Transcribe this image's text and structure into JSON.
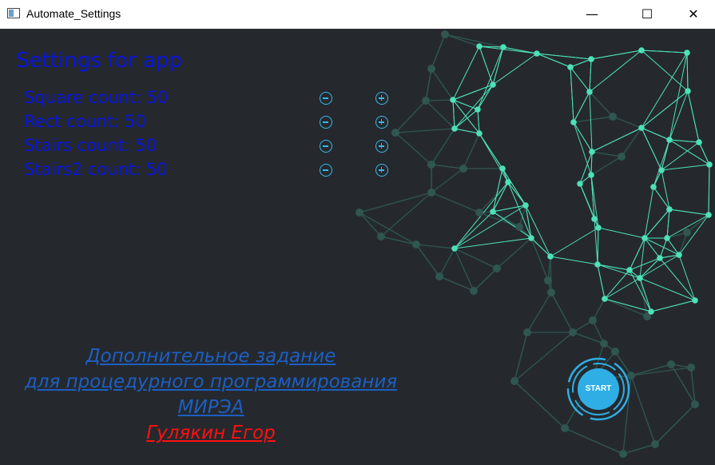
{
  "window": {
    "title": "Automate_Settings",
    "minimize_glyph": "—",
    "maximize_glyph": "☐",
    "close_glyph": "✕"
  },
  "settings": {
    "heading": "Settings for app",
    "counters": [
      {
        "label": "Square count: 50"
      },
      {
        "label": "Rect count: 50"
      },
      {
        "label": "Stairs count: 50"
      },
      {
        "label": "Stairs2 count: 50"
      }
    ]
  },
  "info": {
    "line1": "Дополнительное задание ",
    "line2": "для процедурного программирования ",
    "line3": "МИРЭА",
    "author": "Гулякин Егор"
  },
  "start": {
    "label": "START"
  },
  "colors": {
    "background": "#25292e",
    "label_blue": "#0a16d8",
    "link_blue": "#1d5fc2",
    "author_red": "#ff1010",
    "accent_cyan": "#39b8e8",
    "network_bright": "#4ee0b8",
    "network_dim": "#2f5650"
  },
  "icons": {
    "minus_button": "minus-circle-icon",
    "plus_button": "plus-circle-icon",
    "app_icon": "window-app-icon"
  }
}
